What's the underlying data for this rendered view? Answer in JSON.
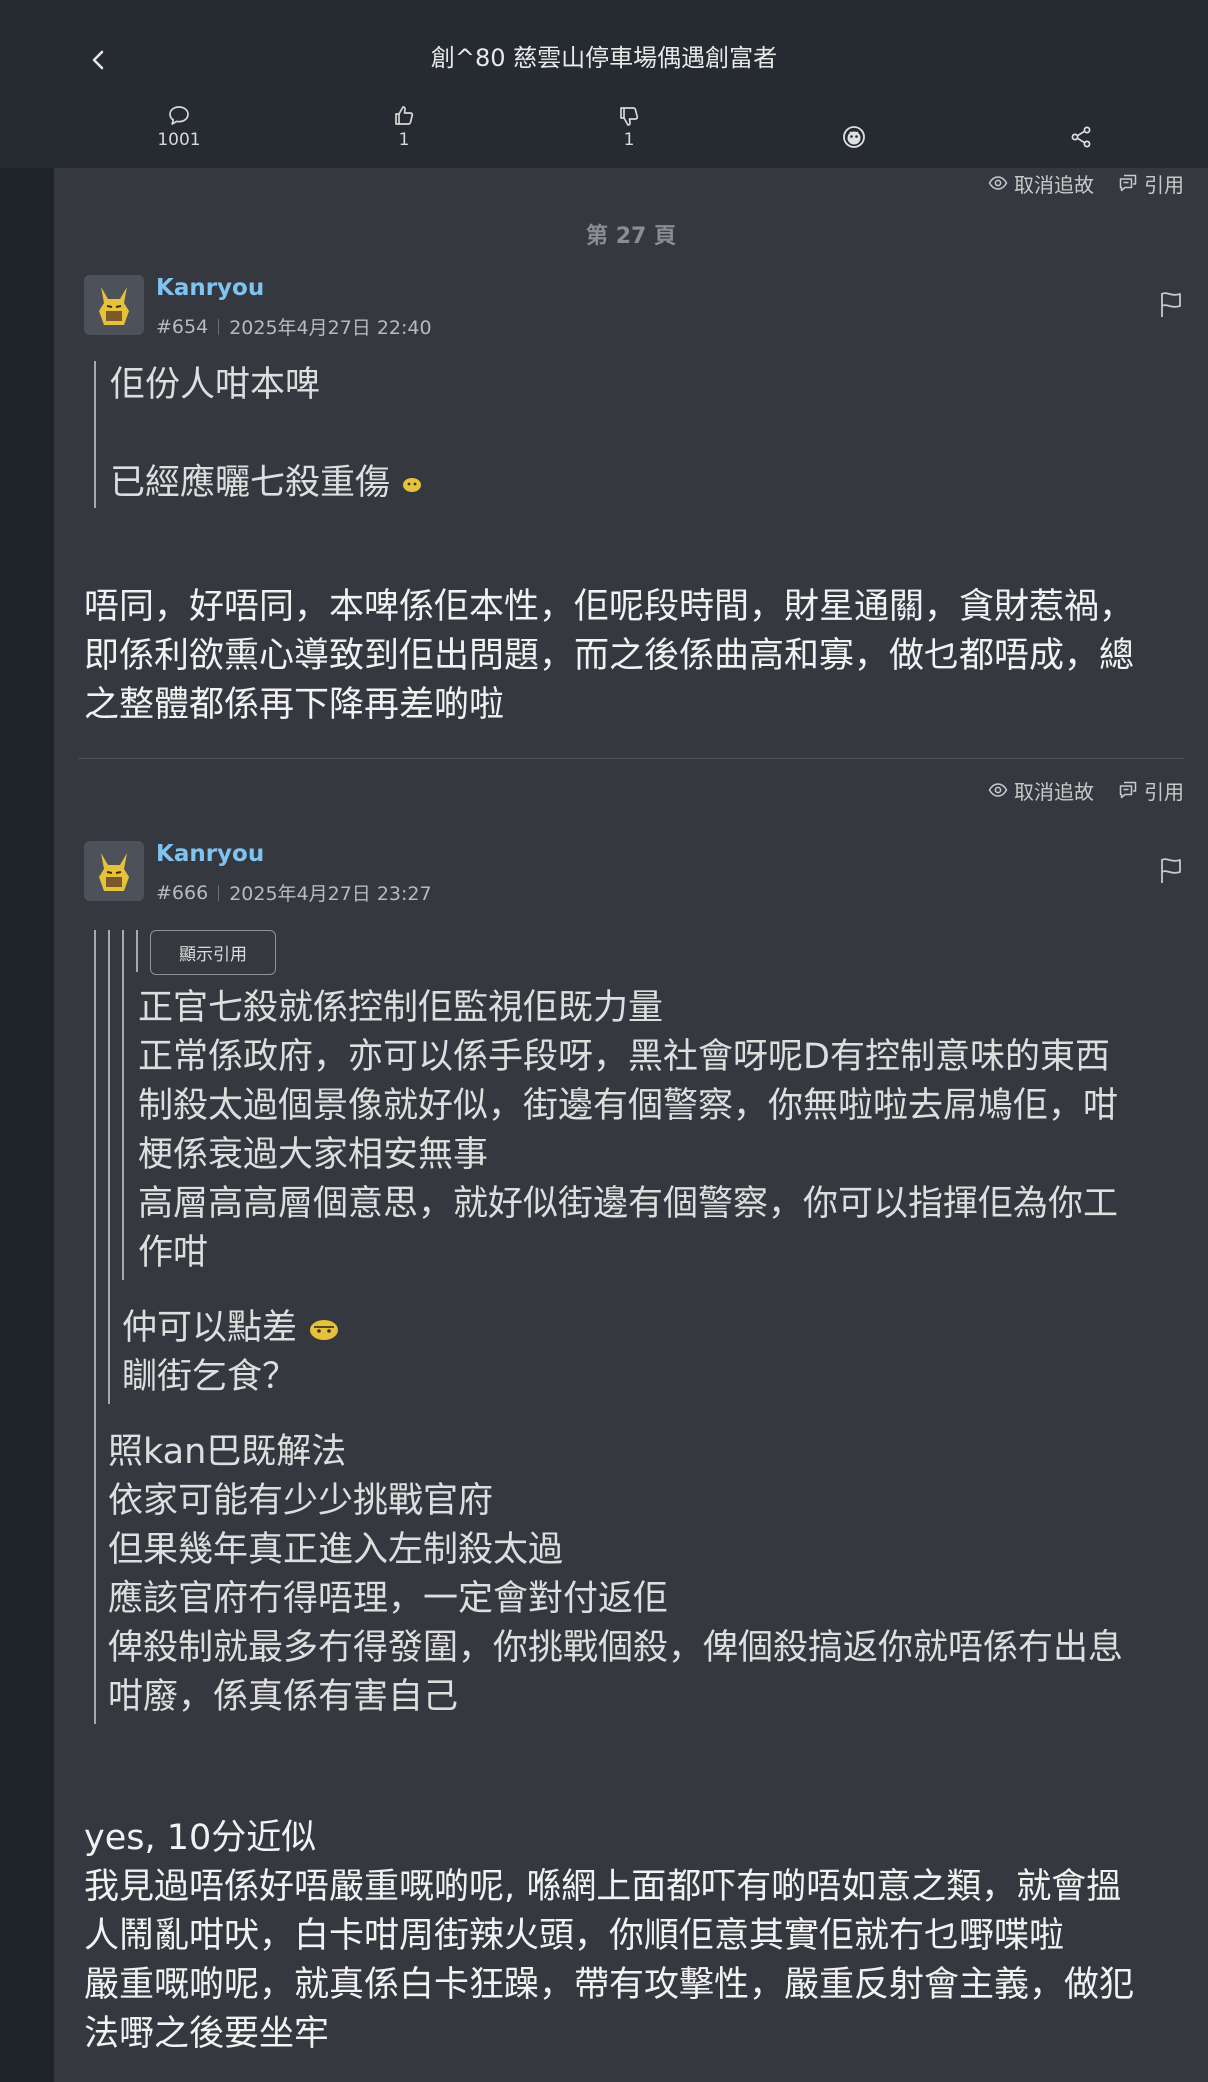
{
  "topbar": {
    "title": "創^80 慈雲山停車場偶遇創富者",
    "replies_count": "1001",
    "likes_count": "1",
    "dislikes_count": "1"
  },
  "page_label": "第 27 頁",
  "post_tools": {
    "unfollow_label": "取消追故",
    "quote_label": "引用"
  },
  "posts": [
    {
      "username": "Kanryou",
      "number": "#654",
      "time": "2025年4月27日 22:40",
      "quote_lines": [
        "佢份人咁本啤",
        "",
        "已經應曬七殺重傷"
      ],
      "body_lines": [
        "唔同，好唔同，本啤係佢本性，佢呢段時間，財星通關，貪財惹禍，",
        "即係利欲熏心導致到佢出問題，而之後係曲高和寡，做乜都唔成，總",
        "之整體都係再下降再差啲啦"
      ]
    },
    {
      "username": "Kanryou",
      "number": "#666",
      "time": "2025年4月27日 23:27",
      "show_quote_label": "顯示引用",
      "quote_level3_lines": [
        "正官七殺就係控制佢監視佢既力量",
        "正常係政府，亦可以係手段呀，黑社會呀呢D有控制意味的東西",
        "制殺太過個景像就好似，街邊有個警察，你無啦啦去屌鳩佢，咁",
        "梗係衰過大家相安無事",
        "高層高高層個意思，就好似街邊有個警察，你可以指揮佢為你工",
        "作咁"
      ],
      "quote_level2_lines": [
        "仲可以點差",
        "瞓街乞食？"
      ],
      "quote_level1_lines": [
        "照kan巴既解法",
        "依家可能有少少挑戰官府",
        "但果幾年真正進入左制殺太過",
        "應該官府冇得唔理，一定會對付返佢",
        "俾殺制就最多冇得發圍，你挑戰個殺，俾個殺搞返你就唔係冇出息",
        "咁廢，係真係有害自己"
      ],
      "body_lines": [
        "yes, 10分近似",
        "我見過唔係好唔嚴重嘅啲呢, 喺網上面都吓有啲唔如意之類，就會搵",
        "人鬧亂咁吠，白卡咁周街辣火頭，你順佢意其實佢就冇乜嘢喋啦",
        "嚴重嘅啲呢，就真係白卡狂躁，帶有攻擊性，嚴重反射會主義，做犯",
        "法嘢之後要坐牢"
      ]
    }
  ]
}
